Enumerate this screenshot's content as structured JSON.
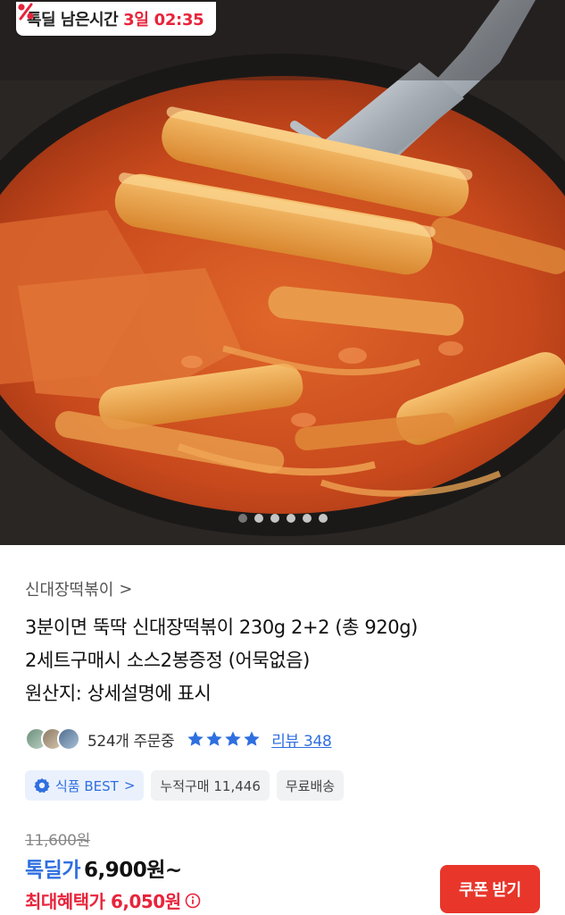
{
  "deal_timer": {
    "icon": "percent-badge-icon",
    "label": "톡딜 남은시간",
    "value": "3일 02:35",
    "accent_color": "#e8243b"
  },
  "gallery": {
    "image_description_icon": "tteokbokki-photo",
    "dot_count": 6,
    "active_index": 0
  },
  "product": {
    "brand": "신대장떡볶이",
    "brand_chevron": ">",
    "title_lines": [
      "3분이면 뚝딱 신대장떡볶이 230g 2+2 (총 920g)",
      "2세트구매시 소스2봉증정 (어묵없음)",
      "원산지: 상세설명에 표시"
    ]
  },
  "social": {
    "order_count": "524개 주문중",
    "rating_stars": 4,
    "review_link": "리뷰 348",
    "star_color": "#2f6fe0"
  },
  "tags": {
    "best": "식품 BEST",
    "best_chevron": ">",
    "cumulative": "누적구매 11,446",
    "shipping": "무료배송"
  },
  "pricing": {
    "original_price": "11,600원",
    "deal_label": "톡딜가",
    "deal_price": "6,900원~",
    "benefit_label": "최대혜택가 6,050원",
    "benefit_icon": "info-icon"
  },
  "coupon_button": {
    "label": "쿠폰 받기",
    "color": "#e8362b"
  }
}
